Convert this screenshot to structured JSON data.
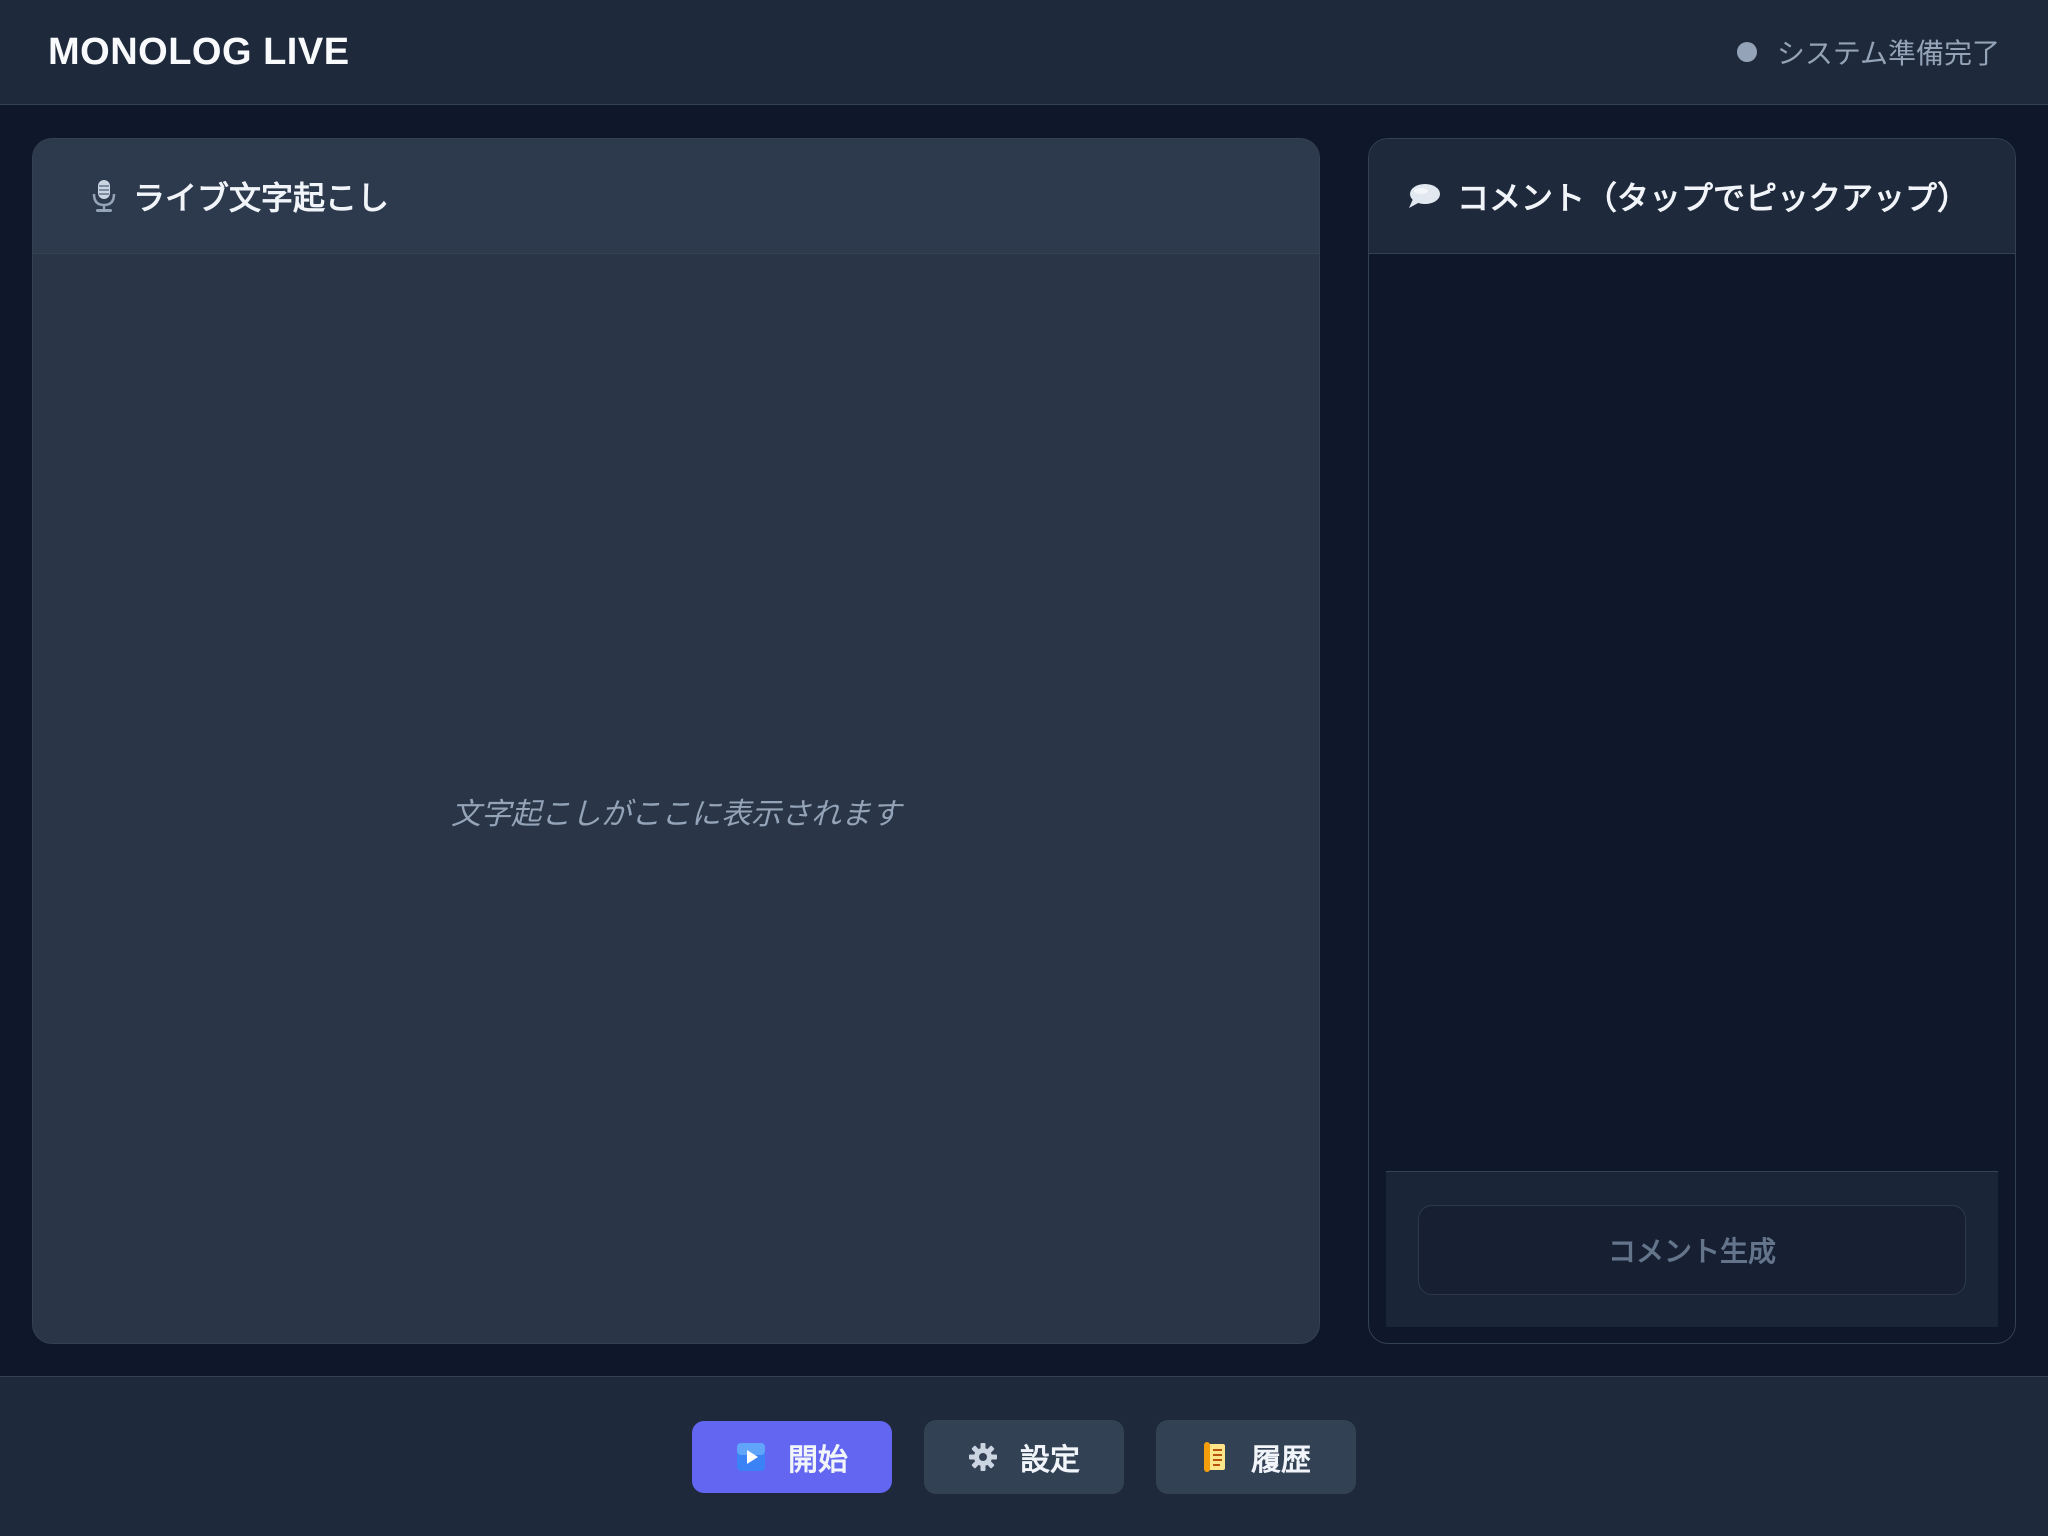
{
  "header": {
    "app_title": "MONOLOG LIVE",
    "status_text": "システム準備完了"
  },
  "transcript_panel": {
    "title": "ライブ文字起こし",
    "icon": "microphone-icon",
    "placeholder": "文字起こしがここに表示されます"
  },
  "comment_panel": {
    "title": "コメント（タップでピックアップ）",
    "icon": "speech-bubble-icon",
    "generate_button": "コメント生成"
  },
  "toolbar": {
    "start_label": "開始",
    "start_icon": "play-icon",
    "settings_label": "設定",
    "settings_icon": "gear-icon",
    "history_label": "履歴",
    "history_icon": "scroll-icon"
  },
  "colors": {
    "background": "#0f172a",
    "surface": "#1e293b",
    "accent": "#6366f1"
  }
}
